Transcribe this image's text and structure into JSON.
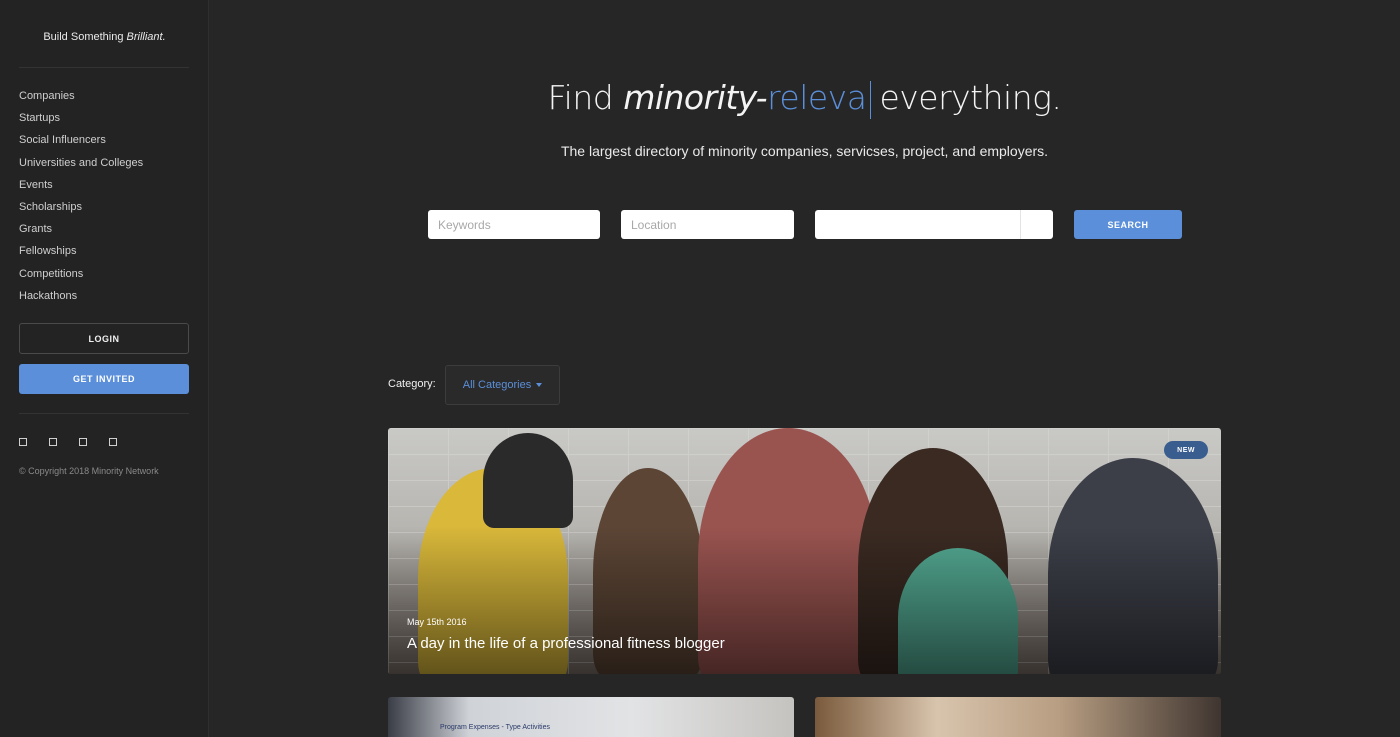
{
  "sidebar": {
    "brand_plain": "Build Something ",
    "brand_italic": "Brilliant.",
    "nav": [
      "Companies",
      "Startups",
      "Social Influencers",
      "Universities and Colleges",
      "Events",
      "Scholarships",
      "Grants",
      "Fellowships",
      "Competitions",
      "Hackathons"
    ],
    "login_label": "LOGIN",
    "invite_label": "GET INVITED",
    "copyright": "© Copyright 2018 Minority Network"
  },
  "hero": {
    "title_prefix": "Find ",
    "title_italic": "minority-",
    "title_accent": "releva",
    "title_suffix": "everything.",
    "subtitle": "The largest directory of minority companies, servicses, project, and employers."
  },
  "search": {
    "keywords_placeholder": "Keywords",
    "location_placeholder": "Location",
    "button_label": "SEARCH"
  },
  "category": {
    "label": "Category:",
    "selected": "All Categories"
  },
  "feature": {
    "badge": "NEW",
    "date": "May 15th 2016",
    "title": "A day in the life of a professional fitness blogger"
  },
  "cards": {
    "slide_text": "Program Expenses - Type Activities"
  },
  "colors": {
    "accent": "#5b8fd9",
    "background": "#262626",
    "badge": "#3a5d8f"
  }
}
